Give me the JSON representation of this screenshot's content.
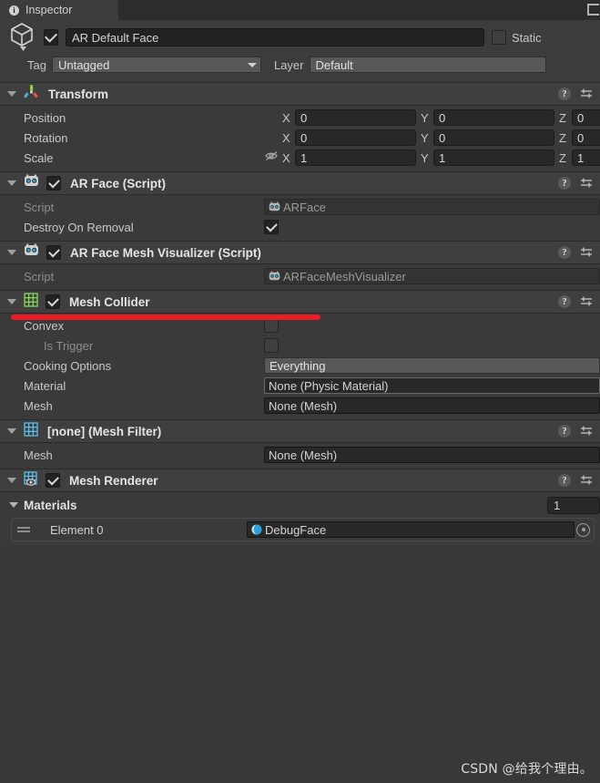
{
  "window": {
    "tab_label": "Inspector",
    "tab_icon": "info-icon",
    "lock_icon": "lock-icon"
  },
  "object_header": {
    "prefab_icon": "cube-icon",
    "enabled_checkbox": "checked",
    "name": "AR Default Face",
    "static_label": "Static",
    "static_checked": "unchecked",
    "tag_label": "Tag",
    "tag_value": "Untagged",
    "layer_label": "Layer",
    "layer_value": "Default"
  },
  "components": [
    {
      "id": "transform",
      "title": "Transform",
      "icon": "transform-gizmo-icon",
      "has_checkbox": false,
      "help_icon": "help-icon",
      "preset_icon": "preset-icon",
      "rows": [
        {
          "label": "Position",
          "x": "0",
          "y": "0",
          "z": "0"
        },
        {
          "label": "Rotation",
          "x": "0",
          "y": "0",
          "z": "0"
        },
        {
          "label": "Scale",
          "x": "1",
          "y": "1",
          "z": "1",
          "lock_icon": "eye-off-icon"
        }
      ],
      "axis_x": "X",
      "axis_y": "Y",
      "axis_z": "Z"
    },
    {
      "id": "ar-face",
      "title": "AR Face (Script)",
      "icon": "script-robot-icon",
      "has_checkbox": true,
      "checked": true,
      "script_label": "Script",
      "script_value": "ARFace",
      "destroy_label": "Destroy On Removal",
      "destroy_checked": true
    },
    {
      "id": "ar-face-mesh-visualizer",
      "title": "AR Face Mesh Visualizer (Script)",
      "icon": "script-robot-icon",
      "has_checkbox": true,
      "checked": true,
      "script_label": "Script",
      "script_value": "ARFaceMeshVisualizer"
    },
    {
      "id": "mesh-collider",
      "title": "Mesh Collider",
      "icon": "mesh-grid-green-icon",
      "has_checkbox": true,
      "checked": true,
      "convex_label": "Convex",
      "convex_checked": false,
      "is_trigger_label": "Is Trigger",
      "is_trigger_checked": false,
      "cooking_label": "Cooking Options",
      "cooking_value": "Everything",
      "material_label": "Material",
      "material_value": "None (Physic Material)",
      "mesh_label": "Mesh",
      "mesh_value": "None (Mesh)"
    },
    {
      "id": "mesh-filter",
      "title": "[none] (Mesh Filter)",
      "icon": "mesh-grid-blue-icon",
      "has_checkbox": false,
      "mesh_label": "Mesh",
      "mesh_value": "None (Mesh)"
    },
    {
      "id": "mesh-renderer",
      "title": "Mesh Renderer",
      "icon": "mesh-renderer-icon",
      "has_checkbox": true,
      "checked": true,
      "materials_label": "Materials",
      "materials_count": "1",
      "element_label": "Element 0",
      "element_value": "DebugFace"
    }
  ],
  "annotation": {
    "type": "red-underline",
    "color": "#ed1c24",
    "targets": "Destroy On Removal"
  },
  "watermark": "CSDN @给我个理由。"
}
